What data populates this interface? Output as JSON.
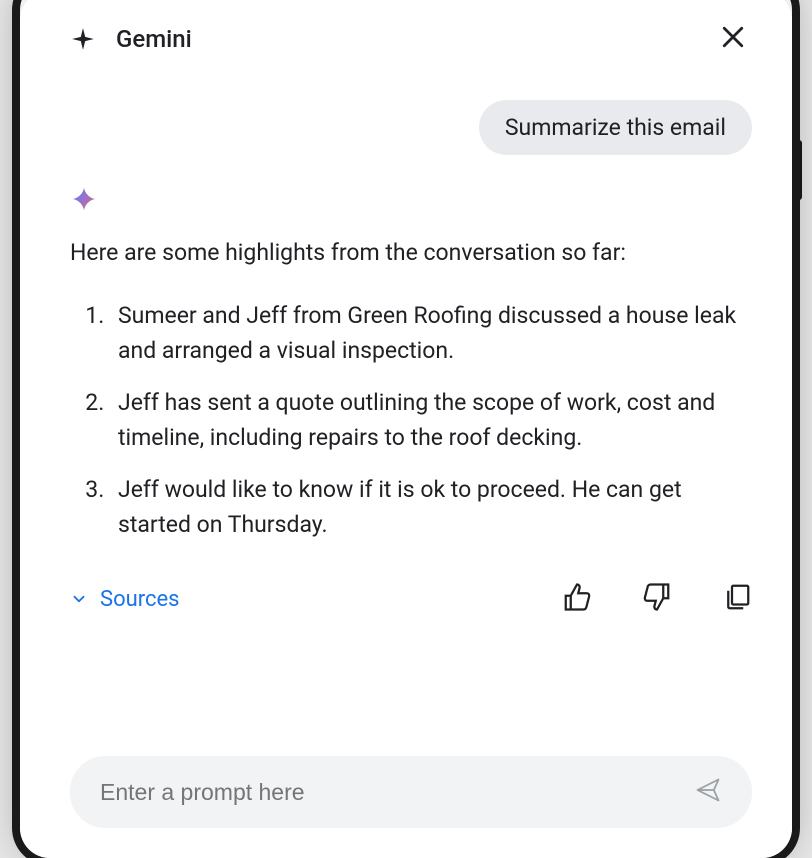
{
  "header": {
    "title": "Gemini"
  },
  "conversation": {
    "user_message": "Summarize this email",
    "intro": "Here are some highlights from the conversation so far:",
    "highlights": [
      "Sumeer and Jeff from Green Roofing discussed a house leak and arranged a visual inspection.",
      "Jeff has sent a quote outlining the scope of work, cost and timeline, including repairs to the roof decking.",
      "Jeff would like to know if it is ok to proceed. He can get started on Thursday."
    ]
  },
  "actions": {
    "sources_label": "Sources"
  },
  "input": {
    "placeholder": "Enter a prompt here"
  }
}
